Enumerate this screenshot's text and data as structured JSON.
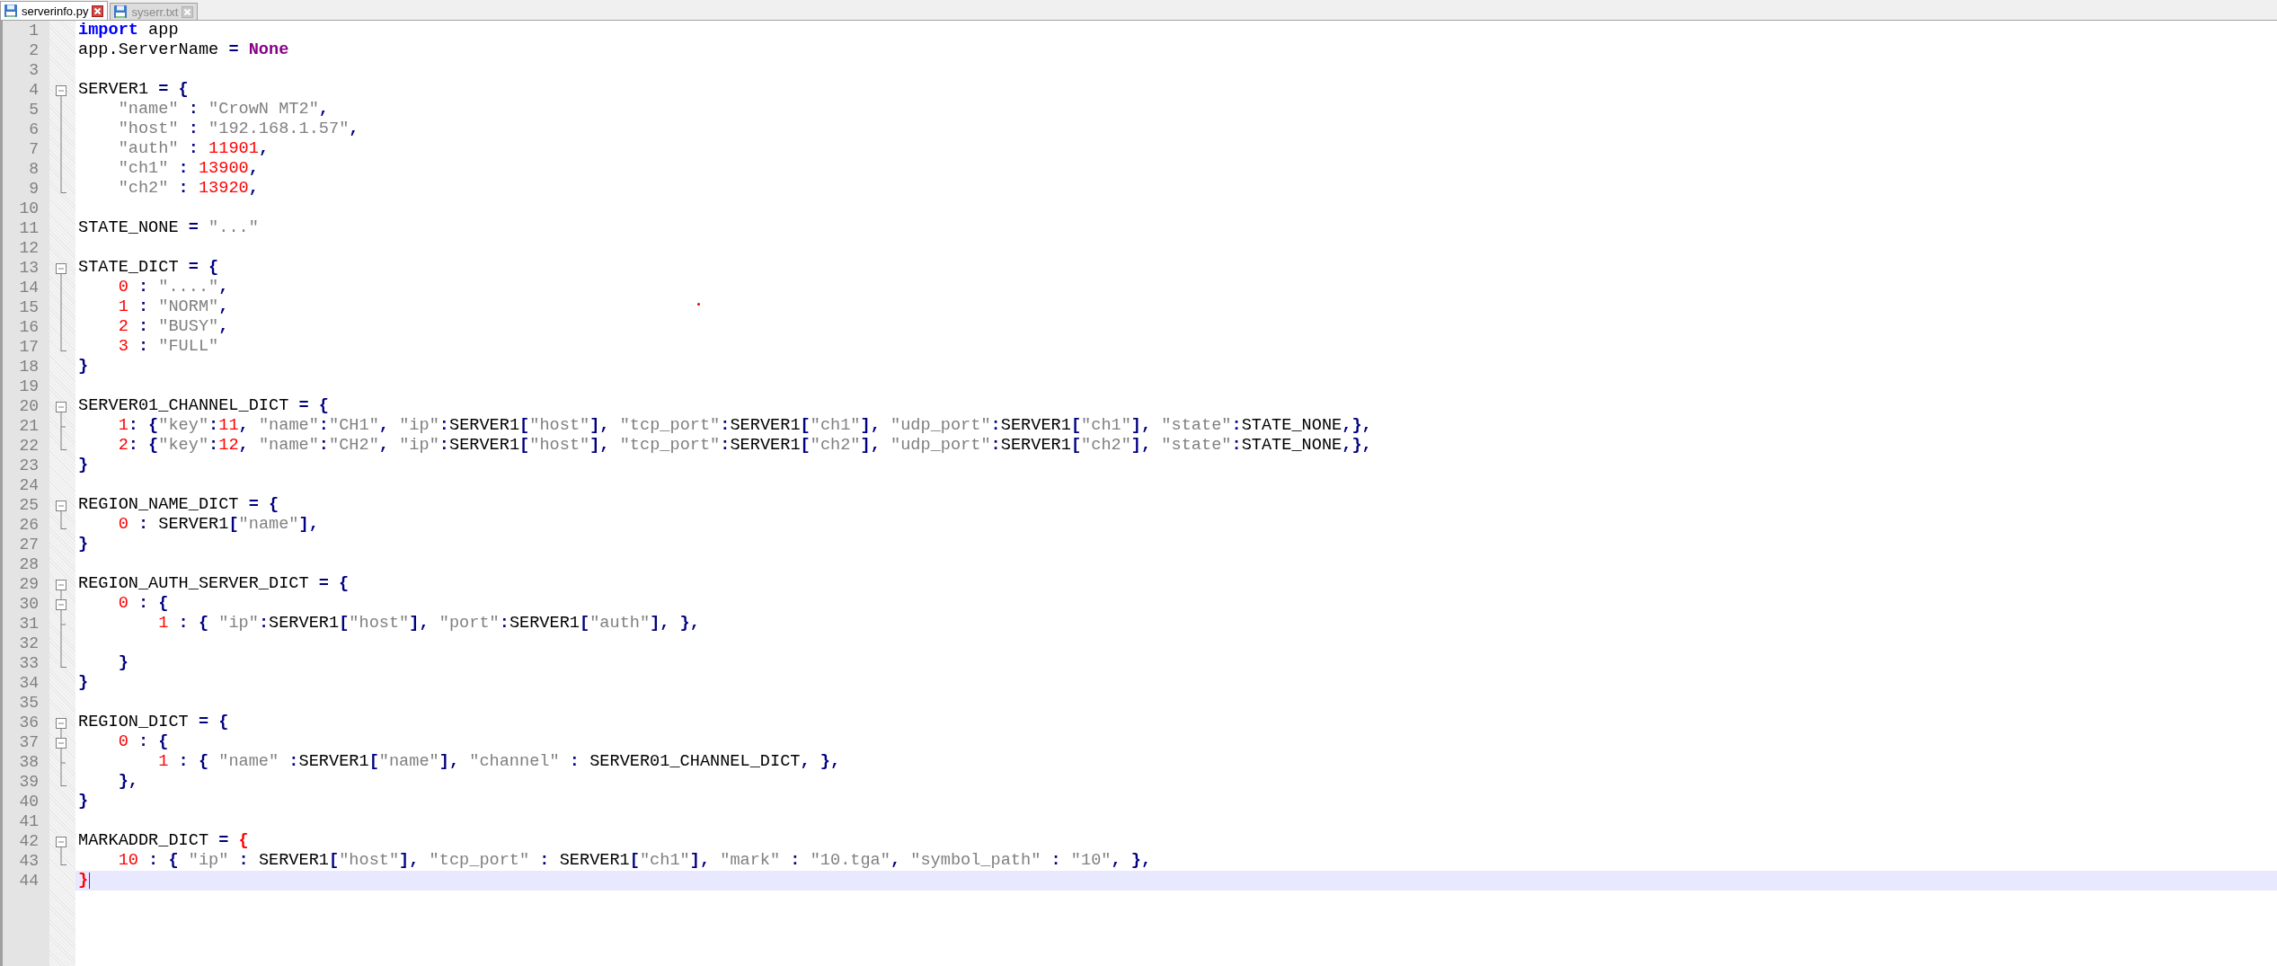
{
  "tabs": [
    {
      "label": "serverinfo.py",
      "selected": true
    },
    {
      "label": "syserr.txt",
      "selected": false
    }
  ],
  "lines": [
    {
      "n": "1",
      "current": false,
      "tokens": [
        {
          "kind": "kw",
          "text": "import"
        },
        {
          "kind": "id",
          "text": " app"
        }
      ]
    },
    {
      "n": "2",
      "current": false,
      "tokens": [
        {
          "kind": "id",
          "text": "app.ServerName "
        },
        {
          "kind": "op",
          "text": "= "
        },
        {
          "kind": "kw2",
          "text": "None"
        }
      ]
    },
    {
      "n": "3",
      "current": false
    },
    {
      "n": "4",
      "current": false,
      "kind": "open",
      "tokens": [
        {
          "kind": "id",
          "text": "SERVER1 "
        },
        {
          "kind": "op",
          "text": "= {"
        }
      ]
    },
    {
      "n": "5",
      "current": false,
      "kind": "line",
      "tokens": [
        {
          "kind": "str",
          "text": "    \"name\" "
        },
        {
          "kind": "op",
          "text": ": "
        },
        {
          "kind": "str",
          "text": "\"CrowN MT2\""
        },
        {
          "kind": "op",
          "text": ","
        }
      ]
    },
    {
      "n": "6",
      "current": false,
      "kind": "line",
      "tokens": [
        {
          "kind": "str",
          "text": "    \"host\" "
        },
        {
          "kind": "op",
          "text": ": "
        },
        {
          "kind": "str",
          "text": "\"192.168.1.57\""
        },
        {
          "kind": "op",
          "text": ","
        }
      ]
    },
    {
      "n": "7",
      "current": false,
      "kind": "line",
      "tokens": [
        {
          "kind": "str",
          "text": "    \"auth\" "
        },
        {
          "kind": "op",
          "text": ": "
        },
        {
          "kind": "num",
          "text": "11901"
        },
        {
          "kind": "op",
          "text": ","
        }
      ]
    },
    {
      "n": "8",
      "current": false,
      "kind": "line",
      "tokens": [
        {
          "kind": "str",
          "text": "    \"ch1\" "
        },
        {
          "kind": "op",
          "text": ": "
        },
        {
          "kind": "num",
          "text": "13900"
        },
        {
          "kind": "op",
          "text": ","
        }
      ]
    },
    {
      "n": "9",
      "current": false,
      "kind": "end",
      "tokens": [
        {
          "kind": "str",
          "text": "    \"ch2\" "
        },
        {
          "kind": "op",
          "text": ": "
        },
        {
          "kind": "num",
          "text": "13920"
        },
        {
          "kind": "op",
          "text": ","
        }
      ]
    },
    {
      "n": "10",
      "current": false
    },
    {
      "n": "11",
      "current": false,
      "tokens": [
        {
          "kind": "id",
          "text": "STATE_NONE "
        },
        {
          "kind": "op",
          "text": "= "
        },
        {
          "kind": "str",
          "text": "\"...\""
        }
      ]
    },
    {
      "n": "12",
      "current": false
    },
    {
      "n": "13",
      "current": false,
      "kind": "open",
      "tokens": [
        {
          "kind": "id",
          "text": "STATE_DICT "
        },
        {
          "kind": "op",
          "text": "= {"
        }
      ]
    },
    {
      "n": "14",
      "current": false,
      "kind": "line",
      "tokens": [
        {
          "kind": "num",
          "text": "    0 "
        },
        {
          "kind": "op",
          "text": ": "
        },
        {
          "kind": "str",
          "text": "\"....\""
        },
        {
          "kind": "op",
          "text": ","
        }
      ]
    },
    {
      "n": "15",
      "current": false,
      "kind": "line",
      "tokens": [
        {
          "kind": "num",
          "text": "    1 "
        },
        {
          "kind": "op",
          "text": ": "
        },
        {
          "kind": "str",
          "text": "\"NORM\""
        },
        {
          "kind": "op",
          "text": ","
        }
      ]
    },
    {
      "n": "16",
      "current": false,
      "kind": "line",
      "tokens": [
        {
          "kind": "num",
          "text": "    2 "
        },
        {
          "kind": "op",
          "text": ": "
        },
        {
          "kind": "str",
          "text": "\"BUSY\""
        },
        {
          "kind": "op",
          "text": ","
        }
      ]
    },
    {
      "n": "17",
      "current": false,
      "kind": "end",
      "tokens": [
        {
          "kind": "num",
          "text": "    3 "
        },
        {
          "kind": "op",
          "text": ": "
        },
        {
          "kind": "str",
          "text": "\"FULL\""
        }
      ]
    },
    {
      "n": "18",
      "current": false,
      "tokens": [
        {
          "kind": "op",
          "text": "}"
        }
      ]
    },
    {
      "n": "19",
      "current": false
    },
    {
      "n": "20",
      "current": false,
      "kind": "open",
      "tokens": [
        {
          "kind": "id",
          "text": "SERVER01_CHANNEL_DICT "
        },
        {
          "kind": "op",
          "text": "= {"
        }
      ]
    },
    {
      "n": "21",
      "current": false,
      "kind": "tee",
      "tokens": [
        {
          "kind": "num",
          "text": "    1"
        },
        {
          "kind": "op",
          "text": ": {"
        },
        {
          "kind": "str",
          "text": "\"key\""
        },
        {
          "kind": "op",
          "text": ":"
        },
        {
          "kind": "num",
          "text": "11"
        },
        {
          "kind": "op",
          "text": ", "
        },
        {
          "kind": "str",
          "text": "\"name\""
        },
        {
          "kind": "op",
          "text": ":"
        },
        {
          "kind": "str",
          "text": "\"CH1\""
        },
        {
          "kind": "op",
          "text": ", "
        },
        {
          "kind": "str",
          "text": "\"ip\""
        },
        {
          "kind": "op",
          "text": ":"
        },
        {
          "kind": "id",
          "text": "SERVER1"
        },
        {
          "kind": "op",
          "text": "["
        },
        {
          "kind": "str",
          "text": "\"host\""
        },
        {
          "kind": "op",
          "text": "], "
        },
        {
          "kind": "str",
          "text": "\"tcp_port\""
        },
        {
          "kind": "op",
          "text": ":"
        },
        {
          "kind": "id",
          "text": "SERVER1"
        },
        {
          "kind": "op",
          "text": "["
        },
        {
          "kind": "str",
          "text": "\"ch1\""
        },
        {
          "kind": "op",
          "text": "], "
        },
        {
          "kind": "str",
          "text": "\"udp_port\""
        },
        {
          "kind": "op",
          "text": ":"
        },
        {
          "kind": "id",
          "text": "SERVER1"
        },
        {
          "kind": "op",
          "text": "["
        },
        {
          "kind": "str",
          "text": "\"ch1\""
        },
        {
          "kind": "op",
          "text": "], "
        },
        {
          "kind": "str",
          "text": "\"state\""
        },
        {
          "kind": "op",
          "text": ":"
        },
        {
          "kind": "id",
          "text": "STATE_NONE"
        },
        {
          "kind": "op",
          "text": ",},"
        }
      ]
    },
    {
      "n": "22",
      "current": false,
      "kind": "end",
      "tokens": [
        {
          "kind": "num",
          "text": "    2"
        },
        {
          "kind": "op",
          "text": ": {"
        },
        {
          "kind": "str",
          "text": "\"key\""
        },
        {
          "kind": "op",
          "text": ":"
        },
        {
          "kind": "num",
          "text": "12"
        },
        {
          "kind": "op",
          "text": ", "
        },
        {
          "kind": "str",
          "text": "\"name\""
        },
        {
          "kind": "op",
          "text": ":"
        },
        {
          "kind": "str",
          "text": "\"CH2\""
        },
        {
          "kind": "op",
          "text": ", "
        },
        {
          "kind": "str",
          "text": "\"ip\""
        },
        {
          "kind": "op",
          "text": ":"
        },
        {
          "kind": "id",
          "text": "SERVER1"
        },
        {
          "kind": "op",
          "text": "["
        },
        {
          "kind": "str",
          "text": "\"host\""
        },
        {
          "kind": "op",
          "text": "], "
        },
        {
          "kind": "str",
          "text": "\"tcp_port\""
        },
        {
          "kind": "op",
          "text": ":"
        },
        {
          "kind": "id",
          "text": "SERVER1"
        },
        {
          "kind": "op",
          "text": "["
        },
        {
          "kind": "str",
          "text": "\"ch2\""
        },
        {
          "kind": "op",
          "text": "], "
        },
        {
          "kind": "str",
          "text": "\"udp_port\""
        },
        {
          "kind": "op",
          "text": ":"
        },
        {
          "kind": "id",
          "text": "SERVER1"
        },
        {
          "kind": "op",
          "text": "["
        },
        {
          "kind": "str",
          "text": "\"ch2\""
        },
        {
          "kind": "op",
          "text": "], "
        },
        {
          "kind": "str",
          "text": "\"state\""
        },
        {
          "kind": "op",
          "text": ":"
        },
        {
          "kind": "id",
          "text": "STATE_NONE"
        },
        {
          "kind": "op",
          "text": ",},"
        }
      ]
    },
    {
      "n": "23",
      "current": false,
      "tokens": [
        {
          "kind": "op",
          "text": "}"
        }
      ]
    },
    {
      "n": "24",
      "current": false
    },
    {
      "n": "25",
      "current": false,
      "kind": "open",
      "tokens": [
        {
          "kind": "id",
          "text": "REGION_NAME_DICT "
        },
        {
          "kind": "op",
          "text": "= {"
        }
      ]
    },
    {
      "n": "26",
      "current": false,
      "kind": "end",
      "tokens": [
        {
          "kind": "num",
          "text": "    0 "
        },
        {
          "kind": "op",
          "text": ": "
        },
        {
          "kind": "id",
          "text": "SERVER1"
        },
        {
          "kind": "op",
          "text": "["
        },
        {
          "kind": "str",
          "text": "\"name\""
        },
        {
          "kind": "op",
          "text": "],"
        }
      ]
    },
    {
      "n": "27",
      "current": false,
      "tokens": [
        {
          "kind": "op",
          "text": "}"
        }
      ]
    },
    {
      "n": "28",
      "current": false
    },
    {
      "n": "29",
      "current": false,
      "kind": "open",
      "tokens": [
        {
          "kind": "id",
          "text": "REGION_AUTH_SERVER_DICT "
        },
        {
          "kind": "op",
          "text": "= {"
        }
      ]
    },
    {
      "n": "30",
      "current": false,
      "kind": "open-inner",
      "tokens": [
        {
          "kind": "num",
          "text": "    0 "
        },
        {
          "kind": "op",
          "text": ": {"
        }
      ]
    },
    {
      "n": "31",
      "current": false,
      "kind": "tee",
      "tokens": [
        {
          "kind": "num",
          "text": "        1 "
        },
        {
          "kind": "op",
          "text": ": { "
        },
        {
          "kind": "str",
          "text": "\"ip\""
        },
        {
          "kind": "op",
          "text": ":"
        },
        {
          "kind": "id",
          "text": "SERVER1"
        },
        {
          "kind": "op",
          "text": "["
        },
        {
          "kind": "str",
          "text": "\"host\""
        },
        {
          "kind": "op",
          "text": "], "
        },
        {
          "kind": "str",
          "text": "\"port\""
        },
        {
          "kind": "op",
          "text": ":"
        },
        {
          "kind": "id",
          "text": "SERVER1"
        },
        {
          "kind": "op",
          "text": "["
        },
        {
          "kind": "str",
          "text": "\"auth\""
        },
        {
          "kind": "op",
          "text": "], },"
        }
      ]
    },
    {
      "n": "32",
      "current": false,
      "kind": "line"
    },
    {
      "n": "33",
      "current": false,
      "kind": "end",
      "tokens": [
        {
          "kind": "op",
          "text": "    }"
        }
      ]
    },
    {
      "n": "34",
      "current": false,
      "tokens": [
        {
          "kind": "op",
          "text": "}"
        }
      ]
    },
    {
      "n": "35",
      "current": false
    },
    {
      "n": "36",
      "current": false,
      "kind": "open",
      "tokens": [
        {
          "kind": "id",
          "text": "REGION_DICT "
        },
        {
          "kind": "op",
          "text": "= {"
        }
      ]
    },
    {
      "n": "37",
      "current": false,
      "kind": "open-inner",
      "tokens": [
        {
          "kind": "num",
          "text": "    0 "
        },
        {
          "kind": "op",
          "text": ": {"
        }
      ]
    },
    {
      "n": "38",
      "current": false,
      "kind": "tee",
      "tokens": [
        {
          "kind": "num",
          "text": "        1 "
        },
        {
          "kind": "op",
          "text": ": { "
        },
        {
          "kind": "str",
          "text": "\"name\" "
        },
        {
          "kind": "op",
          "text": ":"
        },
        {
          "kind": "id",
          "text": "SERVER1"
        },
        {
          "kind": "op",
          "text": "["
        },
        {
          "kind": "str",
          "text": "\"name\""
        },
        {
          "kind": "op",
          "text": "], "
        },
        {
          "kind": "str",
          "text": "\"channel\" "
        },
        {
          "kind": "op",
          "text": ": "
        },
        {
          "kind": "id",
          "text": "SERVER01_CHANNEL_DICT"
        },
        {
          "kind": "op",
          "text": ", },"
        }
      ]
    },
    {
      "n": "39",
      "current": false,
      "kind": "end",
      "tokens": [
        {
          "kind": "op",
          "text": "    },"
        }
      ]
    },
    {
      "n": "40",
      "current": false,
      "tokens": [
        {
          "kind": "op",
          "text": "}"
        }
      ]
    },
    {
      "n": "41",
      "current": false
    },
    {
      "n": "42",
      "current": false,
      "kind": "open",
      "tokens": [
        {
          "kind": "id",
          "text": "MARKADDR_DICT "
        },
        {
          "kind": "op",
          "text": "= "
        },
        {
          "kind": "brace",
          "text": "{"
        }
      ]
    },
    {
      "n": "43",
      "current": false,
      "kind": "end",
      "tokens": [
        {
          "kind": "num",
          "text": "    10 "
        },
        {
          "kind": "op",
          "text": ": { "
        },
        {
          "kind": "str",
          "text": "\"ip\" "
        },
        {
          "kind": "op",
          "text": ": "
        },
        {
          "kind": "id",
          "text": "SERVER1"
        },
        {
          "kind": "op",
          "text": "["
        },
        {
          "kind": "str",
          "text": "\"host\""
        },
        {
          "kind": "op",
          "text": "], "
        },
        {
          "kind": "str",
          "text": "\"tcp_port\" "
        },
        {
          "kind": "op",
          "text": ": "
        },
        {
          "kind": "id",
          "text": "SERVER1"
        },
        {
          "kind": "op",
          "text": "["
        },
        {
          "kind": "str",
          "text": "\"ch1\""
        },
        {
          "kind": "op",
          "text": "], "
        },
        {
          "kind": "str",
          "text": "\"mark\" "
        },
        {
          "kind": "op",
          "text": ": "
        },
        {
          "kind": "str",
          "text": "\"10.tga\""
        },
        {
          "kind": "op",
          "text": ", "
        },
        {
          "kind": "str",
          "text": "\"symbol_path\" "
        },
        {
          "kind": "op",
          "text": ": "
        },
        {
          "kind": "str",
          "text": "\"10\""
        },
        {
          "kind": "op",
          "text": ", },"
        }
      ]
    },
    {
      "n": "44",
      "current": true,
      "tokens": [
        {
          "kind": "brace",
          "text": "}"
        }
      ]
    }
  ]
}
